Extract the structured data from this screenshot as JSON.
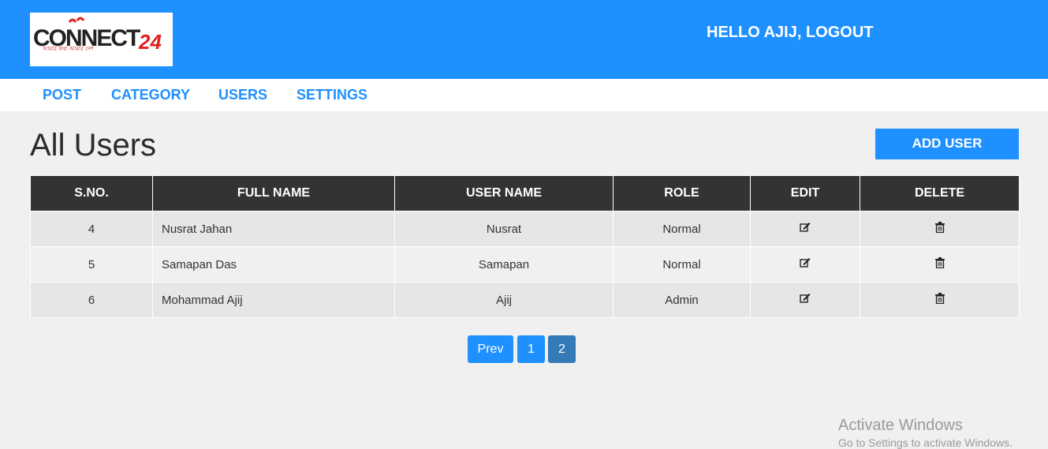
{
  "header": {
    "logo_text": "CONNECT",
    "logo_number": "24",
    "logo_tagline": "আমার কথা আমার দেশ",
    "greeting": "HELLO AJIJ, LOGOUT",
    "bg_color": "#1e90ff"
  },
  "nav": {
    "items": [
      {
        "label": "POST"
      },
      {
        "label": "CATEGORY"
      },
      {
        "label": "USERS"
      },
      {
        "label": "SETTINGS"
      }
    ]
  },
  "main": {
    "title": "All Users",
    "add_button": "ADD USER",
    "table": {
      "columns": [
        "S.NO.",
        "FULL NAME",
        "USER NAME",
        "ROLE",
        "EDIT",
        "DELETE"
      ],
      "rows": [
        {
          "sno": "4",
          "full_name": "Nusrat Jahan",
          "user_name": "Nusrat",
          "role": "Normal",
          "edit_icon": "edit-icon",
          "delete_icon": "trash-icon"
        },
        {
          "sno": "5",
          "full_name": "Samapan Das",
          "user_name": "Samapan",
          "role": "Normal",
          "edit_icon": "edit-icon",
          "delete_icon": "trash-icon"
        },
        {
          "sno": "6",
          "full_name": "Mohammad Ajij",
          "user_name": "Ajij",
          "role": "Admin",
          "edit_icon": "edit-icon",
          "delete_icon": "trash-icon"
        }
      ]
    },
    "pagination": {
      "prev": "Prev",
      "pages": [
        "1",
        "2"
      ],
      "current": "2"
    }
  },
  "watermark": {
    "line1": "Activate Windows",
    "line2": "Go to Settings to activate Windows."
  }
}
